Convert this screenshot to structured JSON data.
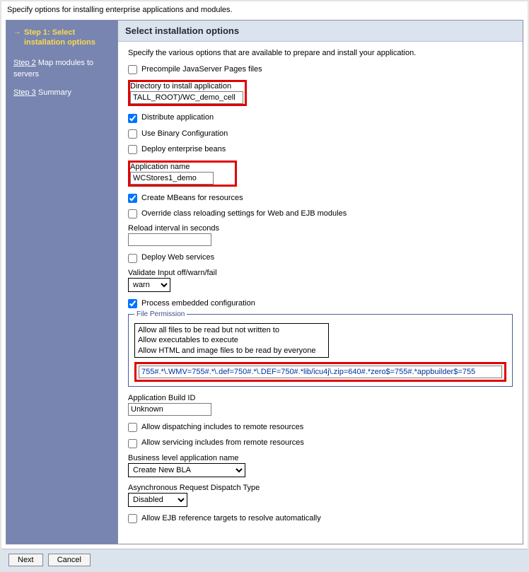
{
  "top_description": "Specify options for installing enterprise applications and modules.",
  "sidebar": {
    "current": {
      "title": "Step 1: Select installation options"
    },
    "step2": {
      "link": "Step 2",
      "rest": "Map modules to servers"
    },
    "step3": {
      "link": "Step 3",
      "rest": "Summary"
    }
  },
  "main": {
    "header": "Select installation options",
    "intro": "Specify the various options that are available to prepare and install your application.",
    "precompile": "Precompile JavaServer Pages files",
    "dir_label": "Directory to install application",
    "dir_value": "TALL_ROOT)/WC_demo_cell",
    "distribute": "Distribute application",
    "use_binary": "Use Binary Configuration",
    "deploy_ejb": "Deploy enterprise beans",
    "appname_label": "Application name",
    "appname_value": "WCStores1_demo",
    "create_mbeans": "Create MBeans for resources",
    "override_reload": "Override class reloading settings for Web and EJB modules",
    "reload_label": "Reload interval in seconds",
    "reload_value": "",
    "deploy_ws": "Deploy Web services",
    "validate_label": "Validate Input off/warn/fail",
    "validate_value": "warn",
    "process_embedded": "Process embedded configuration",
    "file_perm_legend": "File Permission",
    "file_perm_opt1": "Allow all files to be read but not written to",
    "file_perm_opt2": "Allow executables to execute",
    "file_perm_opt3": "Allow HTML and image files to be read by everyone",
    "file_perm_string": "755#.*\\.WMV=755#.*\\.def=750#.*\\.DEF=750#.*lib/icu4j\\.zip=640#.*zero$=755#.*appbuilder$=755",
    "build_id_label": "Application Build ID",
    "build_id_value": "Unknown",
    "allow_dispatch": "Allow dispatching includes to remote resources",
    "allow_service": "Allow servicing includes from remote resources",
    "bla_label": "Business level application name",
    "bla_value": "Create New BLA",
    "async_label": "Asynchronous Request Dispatch Type",
    "async_value": "Disabled",
    "allow_ejb_ref": "Allow EJB reference targets to resolve automatically"
  },
  "footer": {
    "next": "Next",
    "cancel": "Cancel"
  }
}
